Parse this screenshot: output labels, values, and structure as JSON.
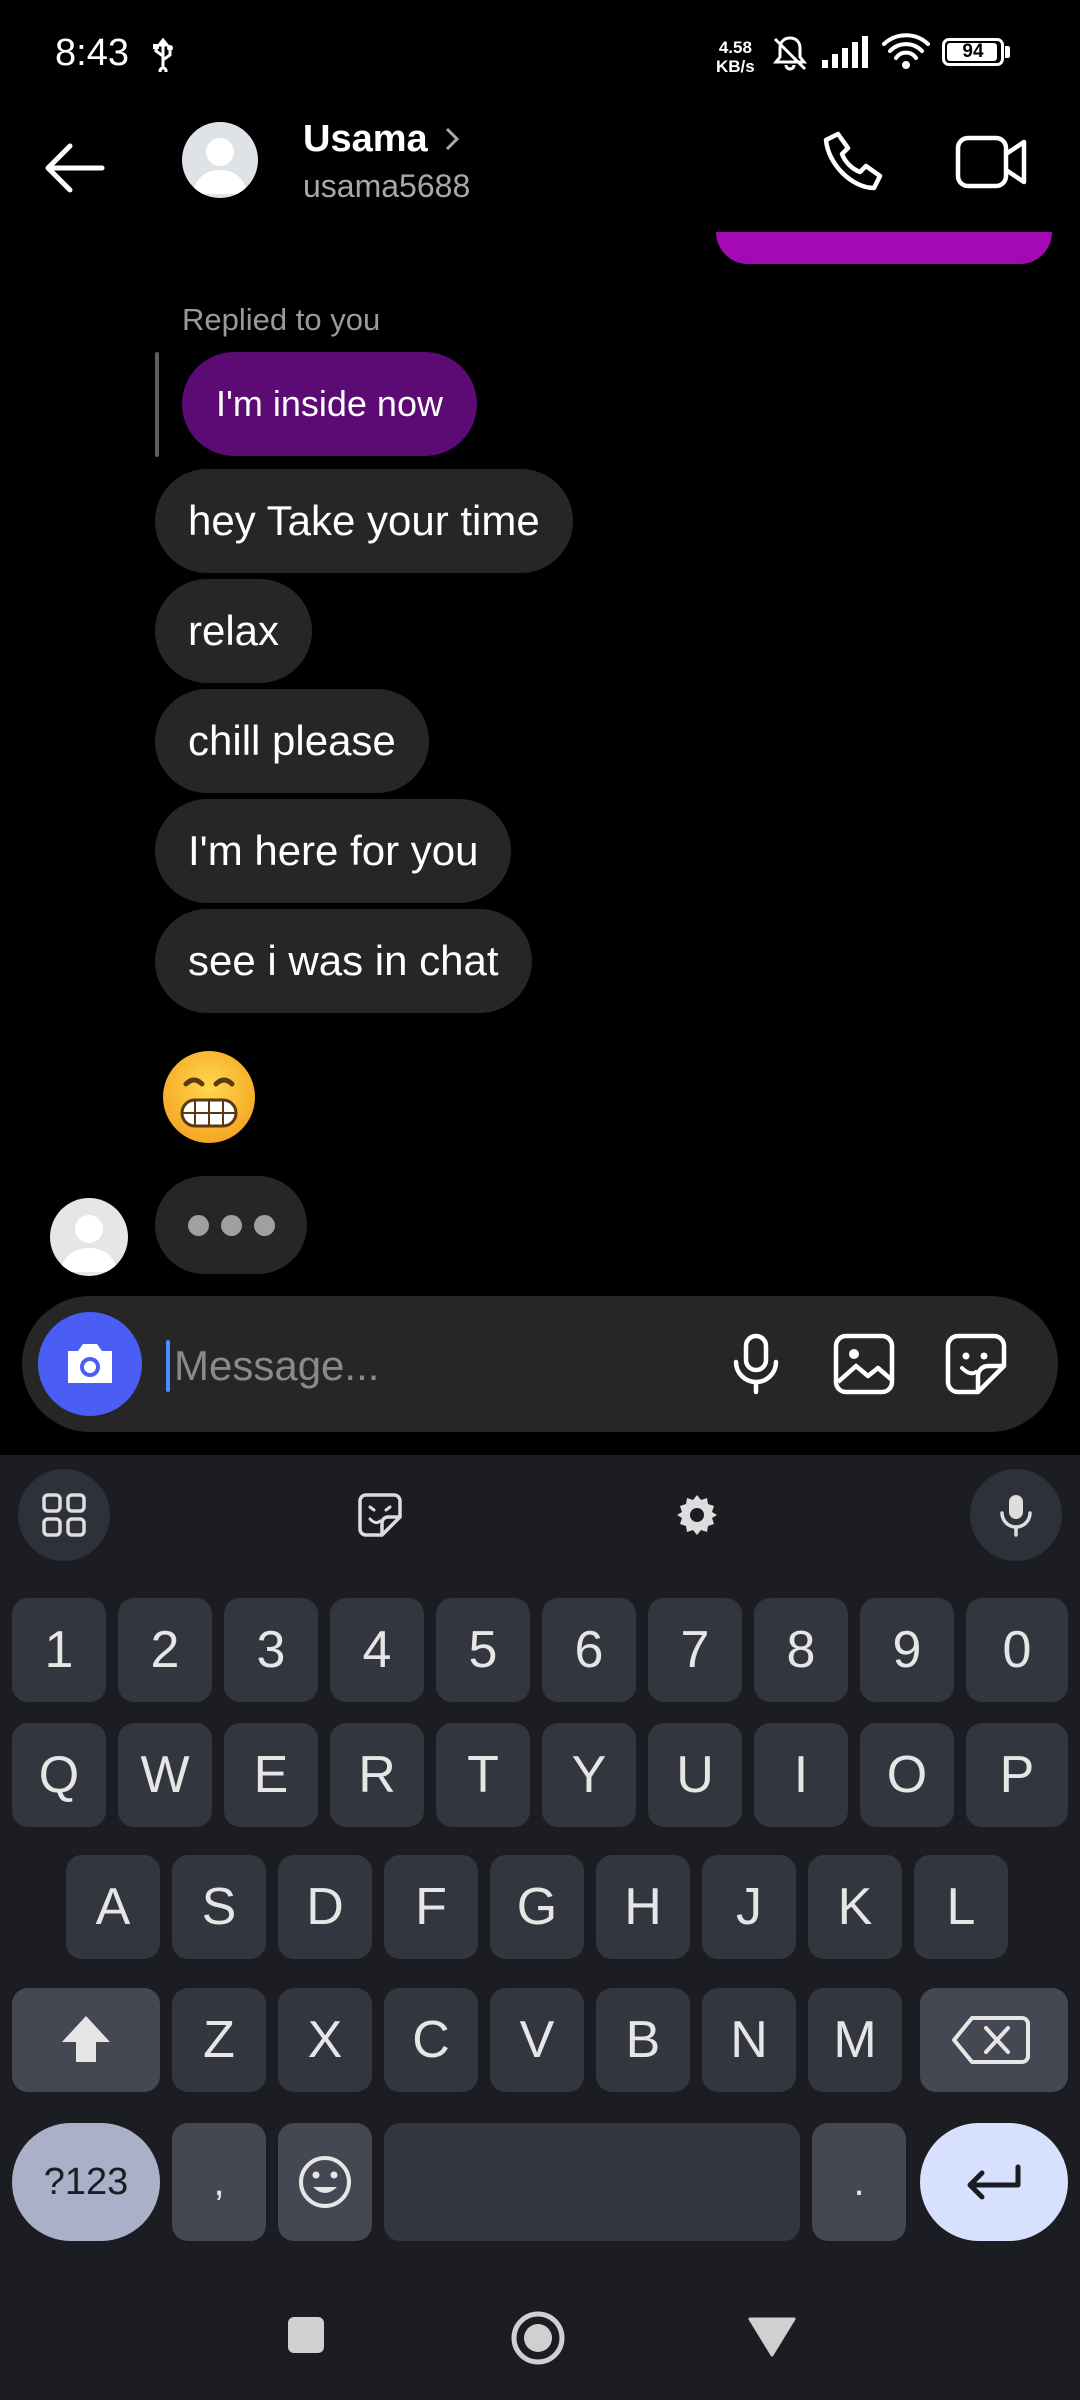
{
  "status_bar": {
    "time": "8:43",
    "net_speed_value": "4.58",
    "net_speed_unit": "KB/s",
    "battery": "94"
  },
  "header": {
    "name": "Usama",
    "username": "usama5688"
  },
  "thread": {
    "reply_label": "Replied to you",
    "replied_message": "I'm inside now",
    "messages": [
      "hey Take your time",
      "relax",
      "chill please",
      "I'm here for you",
      "see i was in chat"
    ],
    "emoji": "grinning-face-with-smiling-eyes"
  },
  "composer": {
    "placeholder": "Message..."
  },
  "keyboard": {
    "number_row": [
      "1",
      "2",
      "3",
      "4",
      "5",
      "6",
      "7",
      "8",
      "9",
      "0"
    ],
    "row1": [
      "Q",
      "W",
      "E",
      "R",
      "T",
      "Y",
      "U",
      "I",
      "O",
      "P"
    ],
    "row2": [
      "A",
      "S",
      "D",
      "F",
      "G",
      "H",
      "J",
      "K",
      "L"
    ],
    "row3": [
      "Z",
      "X",
      "C",
      "V",
      "B",
      "N",
      "M"
    ],
    "symbols_label": "?123",
    "comma": ",",
    "period": "."
  },
  "colors": {
    "sent_bubble": "#a30ab5",
    "replied_bubble": "#5c0a74",
    "received_bubble": "#262626",
    "camera_button": "#4a5df5",
    "keyboard_bg": "#1b1d22"
  }
}
